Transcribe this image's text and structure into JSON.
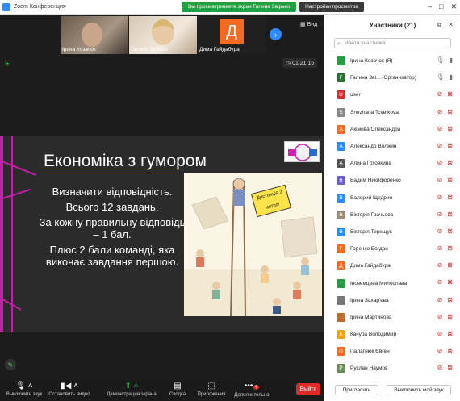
{
  "window": {
    "title": "Zoom Конференция",
    "banner": "Вы просматриваете экран Галина Звірько",
    "view_settings": "Настройки просмотра"
  },
  "thumbnails": [
    {
      "name": "Ірина Козачок"
    },
    {
      "name": "Галина Звірько"
    },
    {
      "name": "Дима Гайдабура",
      "initial": "Д"
    }
  ],
  "view_label": "Вид",
  "timer": "01:21:16",
  "slide": {
    "title": "Економіка з гумором",
    "lines": [
      "Визначити відповідність.",
      "Всього 12 завдань.",
      "За кожну правильну відповідь – 1 бал.",
      "Плюс 2 бали команді, яка виконає завдання першою."
    ],
    "picture_badge": "Дистанція 2 метра!"
  },
  "toolbar": {
    "mute": "Выключить звук",
    "video": "Остановить видео",
    "share": "Демонстрация экрана",
    "summary": "Сводка",
    "apps": "Приложения",
    "more": "Дополнительно",
    "more_badge": "6",
    "leave": "Выйти"
  },
  "panel": {
    "title": "Участники (21)",
    "search_placeholder": "Найти участника",
    "invite": "Пригласить",
    "mute_all": "Выключить мой звук"
  },
  "participants": [
    {
      "name": "Ірина Козачок (Я)",
      "initial": "І",
      "color": "#23a042",
      "mic": "on"
    },
    {
      "name": "Галина Зві... (Организатор)",
      "initial": "Г",
      "color": "#2f6f3a",
      "mic": "on"
    },
    {
      "name": "user",
      "initial": "U",
      "color": "#d0312d",
      "mic": "off"
    },
    {
      "name": "Snezhana Tcvetkova",
      "initial": "S",
      "color": "#8a8a8a",
      "mic": "off"
    },
    {
      "name": "Акімова Олександра",
      "initial": "А",
      "color": "#f36a22",
      "mic": "off"
    },
    {
      "name": "Александр Волжин",
      "initial": "А",
      "color": "#2d8cff",
      "mic": "off"
    },
    {
      "name": "Алина Готовкина",
      "initial": "А",
      "color": "#555555",
      "mic": "off"
    },
    {
      "name": "Вадим Никифоренко",
      "initial": "В",
      "color": "#6b5ed6",
      "mic": "off"
    },
    {
      "name": "Валерий Щедрин",
      "initial": "В",
      "color": "#2d8cff",
      "mic": "off"
    },
    {
      "name": "Вікторія Грачьова",
      "initial": "В",
      "color": "#9a8c7a",
      "mic": "off"
    },
    {
      "name": "Вікторія Терещук",
      "initial": "В",
      "color": "#2d8cff",
      "mic": "off"
    },
    {
      "name": "Горенко Богдан",
      "initial": "Г",
      "color": "#f36a22",
      "mic": "off"
    },
    {
      "name": "Дима Гайдабура",
      "initial": "Д",
      "color": "#f36a22",
      "mic": "off"
    },
    {
      "name": "Іноземцева Милослава",
      "initial": "І",
      "color": "#23a042",
      "mic": "off"
    },
    {
      "name": "Ірина Захар'єва",
      "initial": "І",
      "color": "#777777",
      "mic": "off"
    },
    {
      "name": "Ірина Мартинова",
      "initial": "І",
      "color": "#c46a2a",
      "mic": "off"
    },
    {
      "name": "Качура Володимир",
      "initial": "К",
      "color": "#f0a21e",
      "mic": "off"
    },
    {
      "name": "Палагнюк Євген",
      "initial": "П",
      "color": "#f36a22",
      "mic": "off"
    },
    {
      "name": "Руслан Наумов",
      "initial": "Р",
      "color": "#6a8a5a",
      "mic": "off"
    }
  ]
}
